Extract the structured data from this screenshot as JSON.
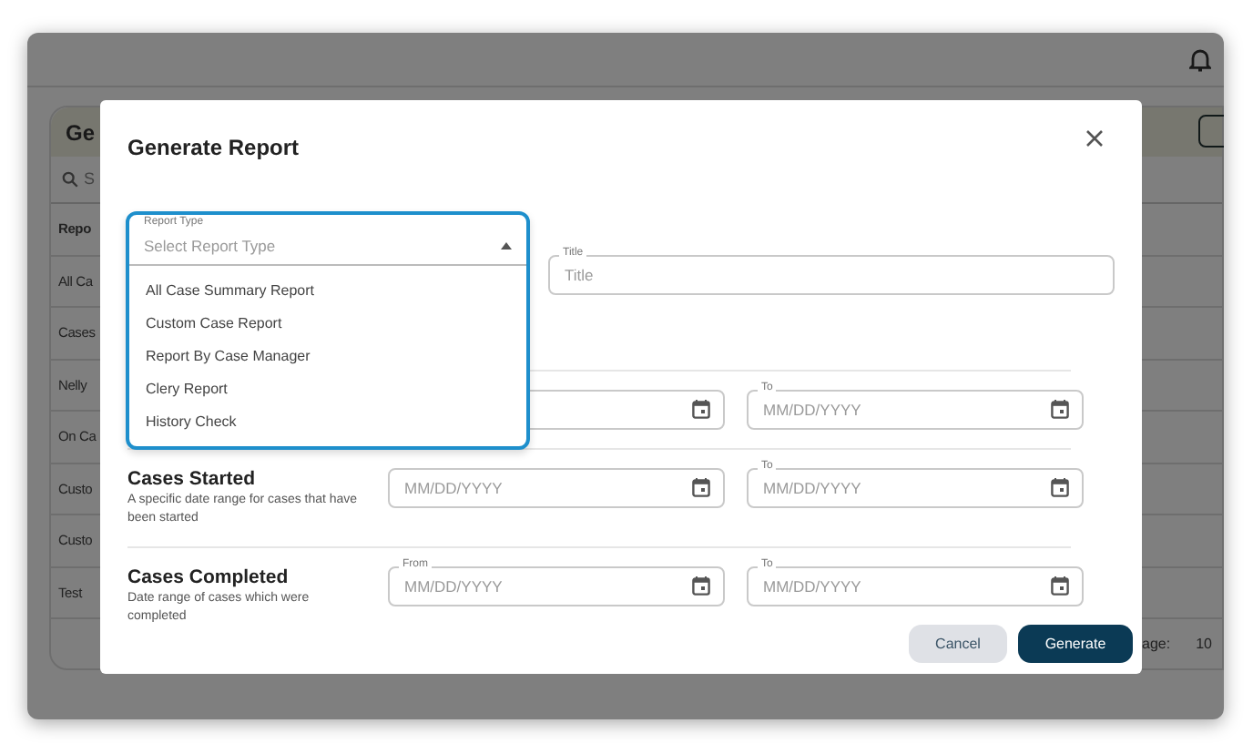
{
  "app": {
    "header_title": "Ge",
    "search_placeholder": "S",
    "rows": [
      {
        "text": "Repo",
        "kind": "header"
      },
      {
        "text": "All Ca",
        "kind": "item"
      },
      {
        "text": "Cases",
        "kind": "item"
      },
      {
        "text": "Nelly",
        "kind": "item"
      },
      {
        "text": "On Ca",
        "kind": "item"
      },
      {
        "text": "Custo",
        "kind": "item"
      },
      {
        "text": "Custo",
        "kind": "item"
      },
      {
        "text": "Test",
        "kind": "item"
      }
    ],
    "footer": {
      "label": "age:",
      "value": "10"
    }
  },
  "modal": {
    "title": "Generate Report",
    "report_type": {
      "label": "Report Type",
      "placeholder": "Select Report Type",
      "expanded": true,
      "options": [
        "All Case Summary Report",
        "Custom Case Report",
        "Report By Case Manager",
        "Clery Report",
        "History Check"
      ]
    },
    "title_field": {
      "label": "Title",
      "placeholder": "Title"
    },
    "date_ranges": [
      {
        "to": {
          "label": "To",
          "placeholder": "MM/DD/YYYY"
        }
      },
      {
        "title": "Cases Started",
        "description": "A specific date range for cases that have been started",
        "from": {
          "placeholder": "MM/DD/YYYY"
        },
        "to": {
          "label": "To",
          "placeholder": "MM/DD/YYYY"
        }
      },
      {
        "title": "Cases Completed",
        "description": "Date range of cases which were completed",
        "from": {
          "label": "From",
          "placeholder": "MM/DD/YYYY"
        },
        "to": {
          "label": "To",
          "placeholder": "MM/DD/YYYY"
        }
      }
    ],
    "buttons": [
      {
        "label": "Cancel",
        "kind": "secondary"
      },
      {
        "label": "Generate",
        "kind": "primary"
      }
    ]
  }
}
